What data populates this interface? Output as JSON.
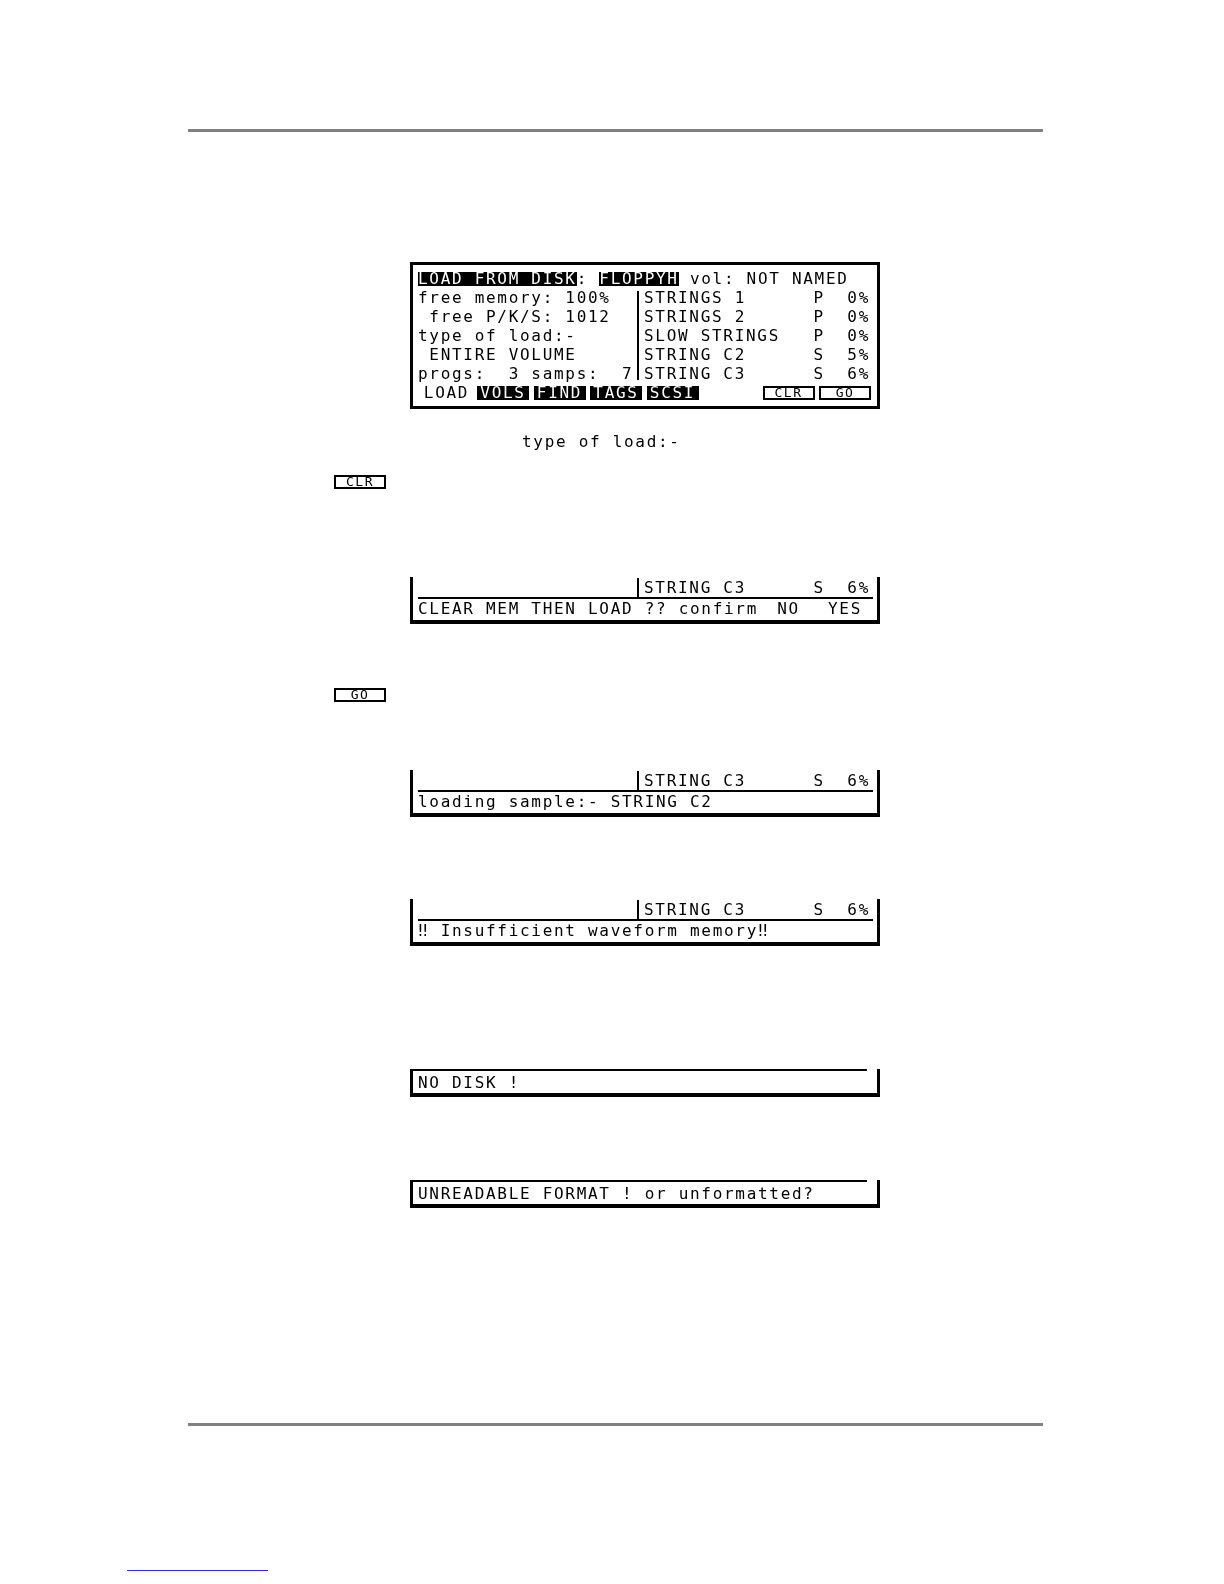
{
  "main_screen": {
    "title": "LOAD FROM DISK",
    "separator": ":",
    "device": "FLOPPYH",
    "volume": "vol: NOT NAMED",
    "info_lines": [
      "free memory: 100%",
      " free P/K/S: 1012",
      "type of load:-",
      " ENTIRE VOLUME",
      "progs:  3 samps:  7"
    ],
    "items": [
      {
        "name": "STRINGS 1",
        "type": "P",
        "size": "0%"
      },
      {
        "name": "STRINGS 2",
        "type": "P",
        "size": "0%"
      },
      {
        "name": "SLOW STRINGS",
        "type": "P",
        "size": "0%"
      },
      {
        "name": "STRING C2",
        "type": "S",
        "size": "5%"
      },
      {
        "name": "STRING C3",
        "type": "S",
        "size": "6%"
      }
    ],
    "page_keys": [
      {
        "label": "LOAD",
        "selected": true
      },
      {
        "label": "VOLS",
        "selected": false
      },
      {
        "label": "FIND",
        "selected": false
      },
      {
        "label": "TAGS",
        "selected": false
      },
      {
        "label": "SCSI",
        "selected": false
      }
    ],
    "action_keys": [
      "CLR",
      "GO"
    ]
  },
  "caption": "type of load:-",
  "clr_key": "CLR",
  "confirm_screen": {
    "item": {
      "name": "STRING C3",
      "type": "S",
      "size": "6%"
    },
    "prompt": "CLEAR MEM THEN LOAD ?? confirm",
    "options": [
      "NO",
      "YES"
    ]
  },
  "go_key": "GO",
  "loading_screen": {
    "item": {
      "name": "STRING C3",
      "type": "S",
      "size": "6%"
    },
    "message": "loading sample:- STRING C2"
  },
  "memory_error_screen": {
    "item": {
      "name": "STRING C3",
      "type": "S",
      "size": "6%"
    },
    "message": "‼ Insufficient waveform memory‼"
  },
  "no_disk_screen": {
    "message": "NO DISK !"
  },
  "format_error_screen": {
    "message": "UNREADABLE FORMAT ! or unformatted?"
  }
}
